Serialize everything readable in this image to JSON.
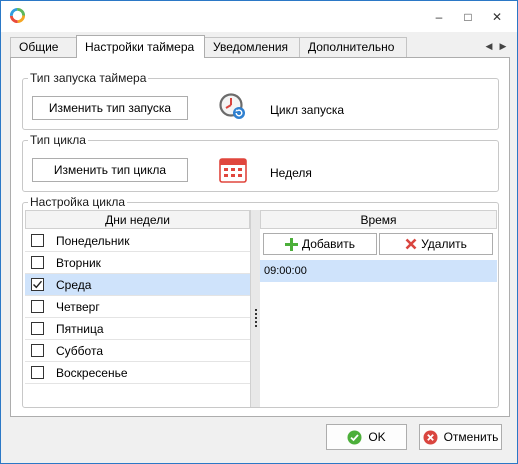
{
  "window": {
    "minimize_glyph": "–",
    "maximize_glyph": "□",
    "close_glyph": "✕"
  },
  "tabs": [
    {
      "label": "Общие"
    },
    {
      "label": "Настройки таймера"
    },
    {
      "label": "Уведомления"
    },
    {
      "label": "Дополнительно"
    }
  ],
  "tab_nav": {
    "prev": "◀",
    "next": "▶"
  },
  "launch_type": {
    "group_label": "Тип запуска таймера",
    "button_label": "Изменить тип запуска",
    "value": "Цикл запуска"
  },
  "cycle_type": {
    "group_label": "Тип цикла",
    "button_label": "Изменить тип цикла",
    "value": "Неделя"
  },
  "cycle_settings": {
    "group_label": "Настройка цикла",
    "days_header": "Дни недели",
    "time_header": "Время",
    "days": [
      {
        "label": "Понедельник",
        "checked": false
      },
      {
        "label": "Вторник",
        "checked": false
      },
      {
        "label": "Среда",
        "checked": true
      },
      {
        "label": "Четверг",
        "checked": false
      },
      {
        "label": "Пятница",
        "checked": false
      },
      {
        "label": "Суббота",
        "checked": false
      },
      {
        "label": "Воскресенье",
        "checked": false
      }
    ],
    "add_label": "Добавить",
    "delete_label": "Удалить",
    "times": [
      "09:00:00"
    ]
  },
  "footer": {
    "ok_label": "OK",
    "cancel_label": "Отменить"
  },
  "colors": {
    "accent": "#2b78c6",
    "selection": "#cfe3fb",
    "ok_green": "#4caf3a",
    "cancel_red": "#d9453f",
    "add_green": "#4caf3a",
    "delete_red": "#d9453f",
    "calendar_red": "#e0463d"
  }
}
